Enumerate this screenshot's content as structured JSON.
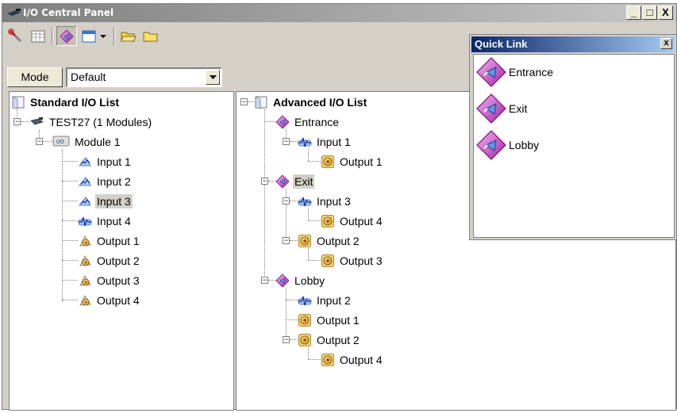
{
  "window": {
    "title": "I/O Central Panel",
    "minimize_label": "_",
    "maximize_label": "□",
    "close_label": "X"
  },
  "toolbar": {
    "icons": [
      "wrench-icon",
      "table-icon",
      "io-list-icon",
      "window-icon",
      "dropdown-arrow-icon",
      "open-folder-icon",
      "folder-icon"
    ]
  },
  "mode": {
    "button_label": "Mode",
    "selected": "Default"
  },
  "standard_tree": {
    "root": "Standard I/O List",
    "device": "TEST27 (1 Modules)",
    "module": "Module 1",
    "items": [
      "Input 1",
      "Input 2",
      "Input 3",
      "Input 4",
      "Output 1",
      "Output 2",
      "Output 3",
      "Output 4"
    ],
    "selected_item": "Input 3"
  },
  "advanced_tree": {
    "root": "Advanced I/O List",
    "groups": [
      {
        "label": "Entrance",
        "children": [
          {
            "label": "Input 1",
            "type": "input",
            "children": [
              {
                "label": "Output 1",
                "type": "output"
              }
            ]
          }
        ]
      },
      {
        "label": "Exit",
        "selected": true,
        "children": [
          {
            "label": "Input 3",
            "type": "input",
            "children": [
              {
                "label": "Output 4",
                "type": "output"
              }
            ]
          },
          {
            "label": "Output 2",
            "type": "output",
            "children": [
              {
                "label": "Output 3",
                "type": "output"
              }
            ]
          }
        ]
      },
      {
        "label": "Lobby",
        "children": [
          {
            "label": "Input 2",
            "type": "input"
          },
          {
            "label": "Output 1",
            "type": "output"
          },
          {
            "label": "Output 2",
            "type": "output",
            "children": [
              {
                "label": "Output 4",
                "type": "output"
              }
            ]
          }
        ]
      }
    ]
  },
  "quick_link": {
    "title": "Quick Link",
    "close_label": "x",
    "items": [
      "Entrance",
      "Exit",
      "Lobby"
    ]
  },
  "colors": {
    "window_bg": "#d4d0c8",
    "active_title": "#0a246a",
    "selection_bg": "#d4d0c8",
    "group_icon": "#c040c0",
    "output_icon": "#d8a020"
  }
}
